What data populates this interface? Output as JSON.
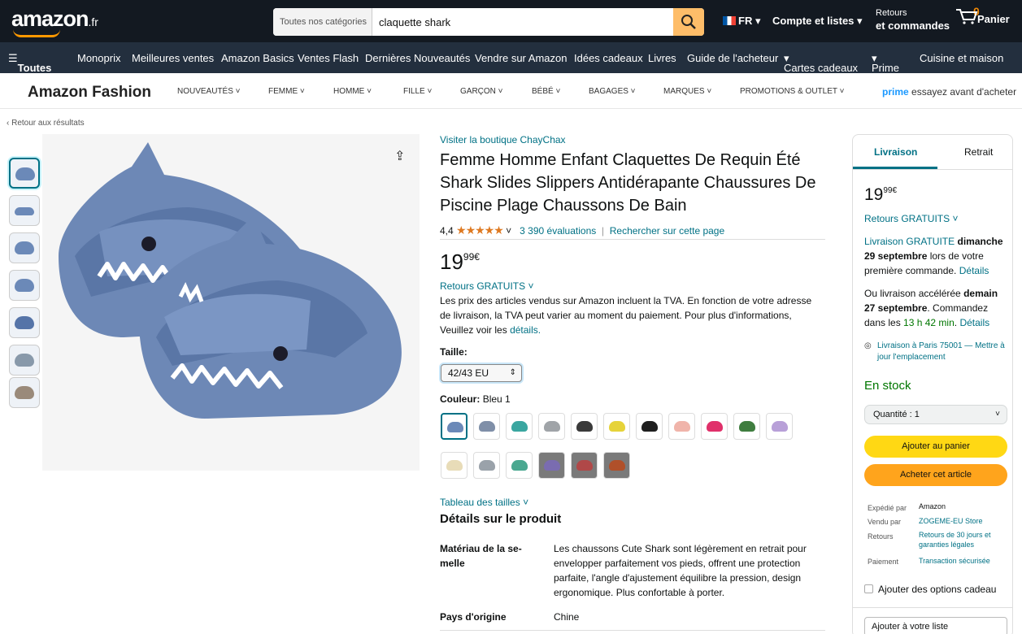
{
  "header": {
    "logo": "amazon",
    "logo_suffix": ".fr",
    "search_category": "Toutes nos catégories",
    "search_value": "claquette shark",
    "lang": "FR",
    "account": "Compte et listes",
    "returns_small": "Retours",
    "returns_label": "et commandes",
    "cart_count": "0",
    "cart_label": "Panier"
  },
  "subnav": {
    "all": "Toutes",
    "items": [
      "Monoprix",
      "Meilleures ventes",
      "Amazon Basics",
      "Ventes Flash",
      "Dernières Nouveautés",
      "Vendre sur Amazon",
      "Idées cadeaux",
      "Livres",
      "Guide de l'acheteur",
      "Cartes cadeaux",
      "Prime",
      "Cuisine et maison"
    ]
  },
  "fashion": {
    "title": "Amazon Fashion",
    "items": [
      "NOUVEAUTÉS",
      "FEMME",
      "HOMME",
      "FILLE",
      "GARÇON",
      "BÉBÉ",
      "BAGAGES",
      "MARQUES",
      "PROMOTIONS & OUTLET"
    ],
    "prime_word": "prime",
    "prime_text": "essayez avant d'acheter"
  },
  "back_link": "‹ Retour aux résultats",
  "product": {
    "store_link": "Visiter la boutique ChayChax",
    "title": "Femme Homme Enfant Claquettes De Requin Été Shark Slides Slippers Antidérapante Chaussures De Piscine Plage Chaussons De Bain",
    "rating_value": "4,4",
    "stars": 4.5,
    "stars_glyphs": "★★★★★",
    "reviews": "3 390 évaluations",
    "search_page": "Rechercher sur cette page",
    "price_whole": "19",
    "price_fraction": "99",
    "currency": "€",
    "returns": "Retours GRATUITS",
    "vat_text": "Les prix des articles vendus sur Amazon incluent la TVA. En fonction de votre adresse de livraison, la TVA peut varier au moment du paiement. Pour plus d'informations, Veuillez voir les",
    "vat_link": "détails.",
    "size_label": "Taille:",
    "size_value": "42/43 EU",
    "color_label": "Couleur:",
    "color_value": "Bleu 1",
    "sizes_link": "Tableau des tailles",
    "details_title": "Détails sur le produit",
    "details": [
      {
        "label": "Matériau de la se-melle",
        "value": "Les chaussons Cute Shark sont légèrement en retrait pour envelopper parfaitement vos pieds, offrent une protection parfaite, l'angle d'ajustement équilibre la pression, design ergonomique. Plus confortable à porter."
      },
      {
        "label": "Pays d'origine",
        "value": "Chine"
      }
    ]
  },
  "swatch_colors": [
    "#6b89b8",
    "#7f8fa8",
    "#3aa6a0",
    "#a0a4a8",
    "#3a3a3a",
    "#e6d33a",
    "#1f1f1f",
    "#f0b4aa",
    "#e0306a",
    "#3f7d3f",
    "#b8a0d8",
    "#e8dcb8",
    "#9aa2aa",
    "#4aa890",
    "#7a6cb0",
    "#b04848",
    "#b0502a"
  ],
  "buybox": {
    "tab_delivery": "Livraison",
    "tab_pickup": "Retrait",
    "price_whole": "19",
    "price_fraction": "99",
    "currency": "€",
    "returns": "Retours GRATUITS",
    "free_delivery_link": "Livraison GRATUITE",
    "free_delivery_date": "dimanche 29 septembre",
    "free_delivery_rest": "lors de votre première commande.",
    "details_link": "Détails",
    "fast_prefix": "Ou livraison accélérée",
    "fast_date": "demain 27 septembre",
    "fast_order": ". Commandez dans les",
    "fast_time": "13 h 42 min",
    "location": "Livraison à Paris 75001 — Mettre à jour l'emplacement",
    "stock": "En stock",
    "quantity": "Quantité : 1",
    "add_to_cart": "Ajouter au panier",
    "buy_now": "Acheter cet article",
    "shipped_by_label": "Expédié par",
    "shipped_by": "Amazon",
    "sold_by_label": "Vendu par",
    "sold_by": "ZOGEME-EU Store",
    "returns_label": "Retours",
    "returns_value": "Retours de 30 jours et garanties légales",
    "payment_label": "Paiement",
    "payment_value": "Transaction sécurisée",
    "gift_options": "Ajouter des options cadeau",
    "add_to_list": "Ajouter à votre liste"
  }
}
